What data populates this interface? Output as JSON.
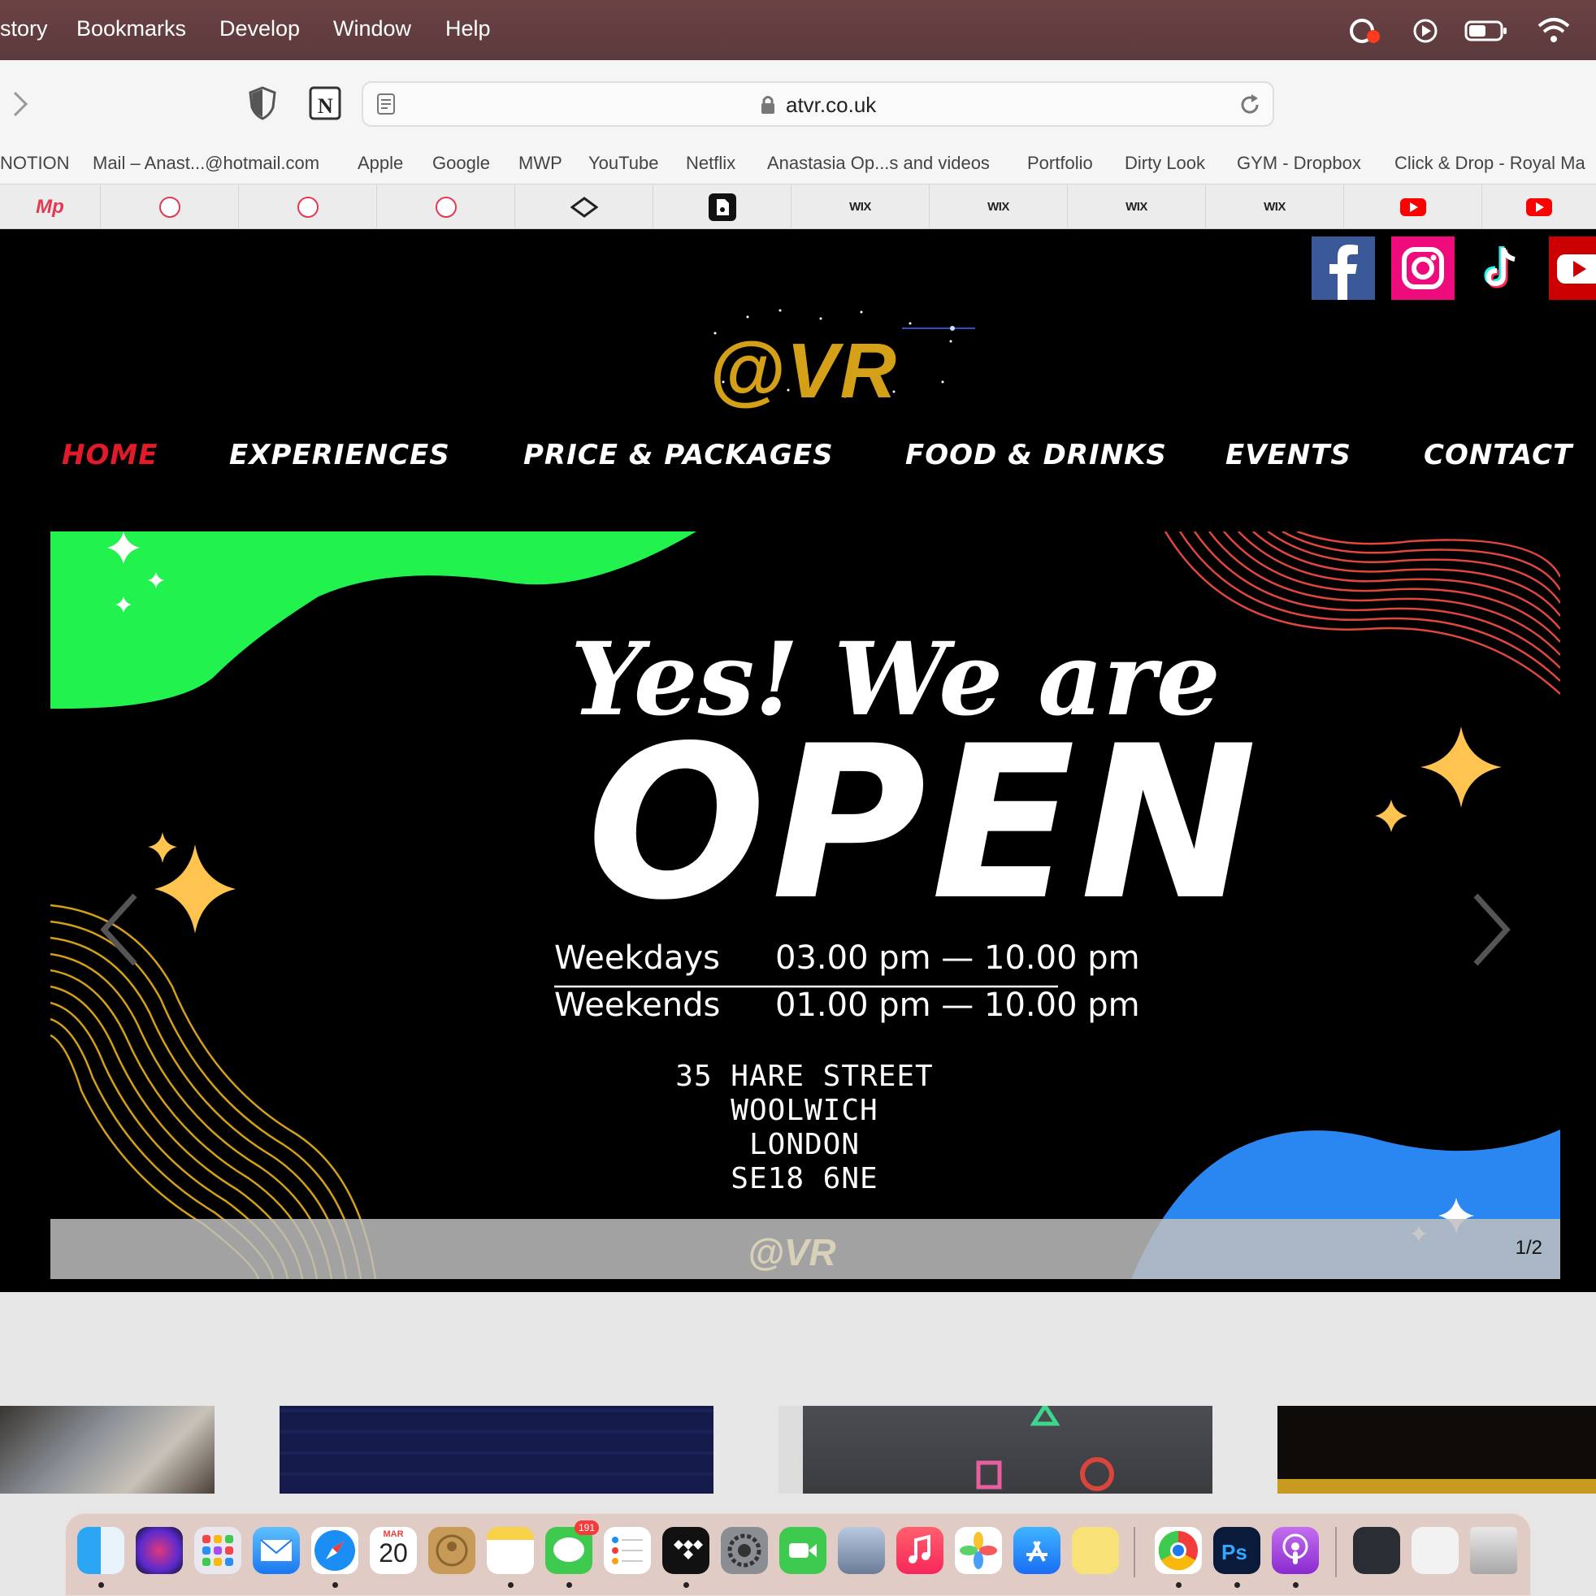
{
  "menubar": {
    "items": [
      "story",
      "Bookmarks",
      "Develop",
      "Window",
      "Help"
    ]
  },
  "toolbar": {
    "url": "atvr.co.uk",
    "favorites": [
      "NOTION",
      "Mail – Anast...@hotmail.com",
      "Apple",
      "Google",
      "MWP",
      "YouTube",
      "Netflix",
      "Anastasia Op...s and videos",
      "Portfolio",
      "Dirty Look",
      "GYM - Dropbox",
      "Click & Drop - Royal Ma"
    ]
  },
  "tabs": {
    "first_label": "Mp",
    "wix_label": "WIX"
  },
  "site": {
    "logo": "@VR",
    "nav": [
      "HOME",
      "EXPERIENCES",
      "PRICE & PACKAGES",
      "FOOD & DRINKS",
      "EVENTS",
      "CONTACT"
    ],
    "banner": {
      "script": "Yes! We are",
      "open": "OPEN",
      "weekdays_label": "Weekdays",
      "weekdays_time": "03.00 pm — 10.00 pm",
      "weekends_label": "Weekends",
      "weekends_time": "01.00 pm — 10.00 pm",
      "address": [
        "35 HARE STREET",
        "WOOLWICH",
        "LONDON",
        "SE18 6NE"
      ],
      "footer_logo": "@VR",
      "counter": "1/2"
    }
  },
  "dock": {
    "calendar_month": "MAR",
    "calendar_day": "20",
    "messages_badge": "191"
  },
  "colors": {
    "accent_red": "#e21b2a",
    "logo_gold": "#d4a017",
    "green_wave": "#22f24e",
    "blue_wave": "#2a86f0",
    "menubar": "#623e40"
  }
}
